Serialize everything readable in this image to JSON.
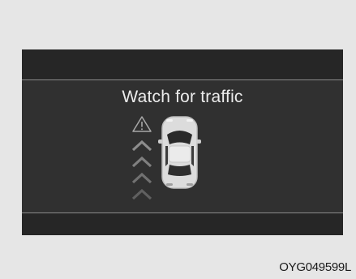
{
  "display": {
    "message": "Watch for traffic",
    "warning_icon": "warning-triangle-icon",
    "vehicle_icon": "car-top-view-icon",
    "approach_indicator": "chevron-up-stack-icon",
    "chevron_count": 4
  },
  "caption": {
    "code": "OYG049599L"
  },
  "colors": {
    "page_background": "#e6e6e6",
    "display_background": "#303030",
    "band_background": "#262626",
    "text": "#ececec"
  }
}
